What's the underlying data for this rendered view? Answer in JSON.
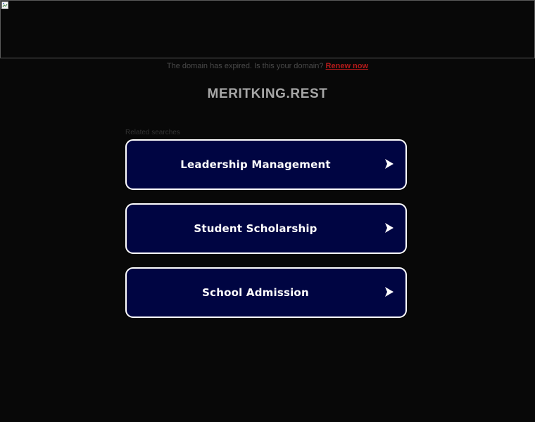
{
  "banner": {
    "icon": "broken-image-icon"
  },
  "notice": {
    "text": "The domain has expired. Is this your domain?",
    "renew_label": "Renew now"
  },
  "domain": {
    "title": "MERITKING.REST"
  },
  "related": {
    "label": "Related searches",
    "items": [
      {
        "label": "Leadership Management",
        "icon": "arrow-right-icon"
      },
      {
        "label": "Student Scholarship",
        "icon": "arrow-right-icon"
      },
      {
        "label": "School Admission",
        "icon": "arrow-right-icon"
      }
    ]
  },
  "colors": {
    "background": "#080808",
    "button_bg": "#000542",
    "button_border": "#ffffff",
    "renew_link": "#b51a1a",
    "title": "#a7a7a7"
  }
}
